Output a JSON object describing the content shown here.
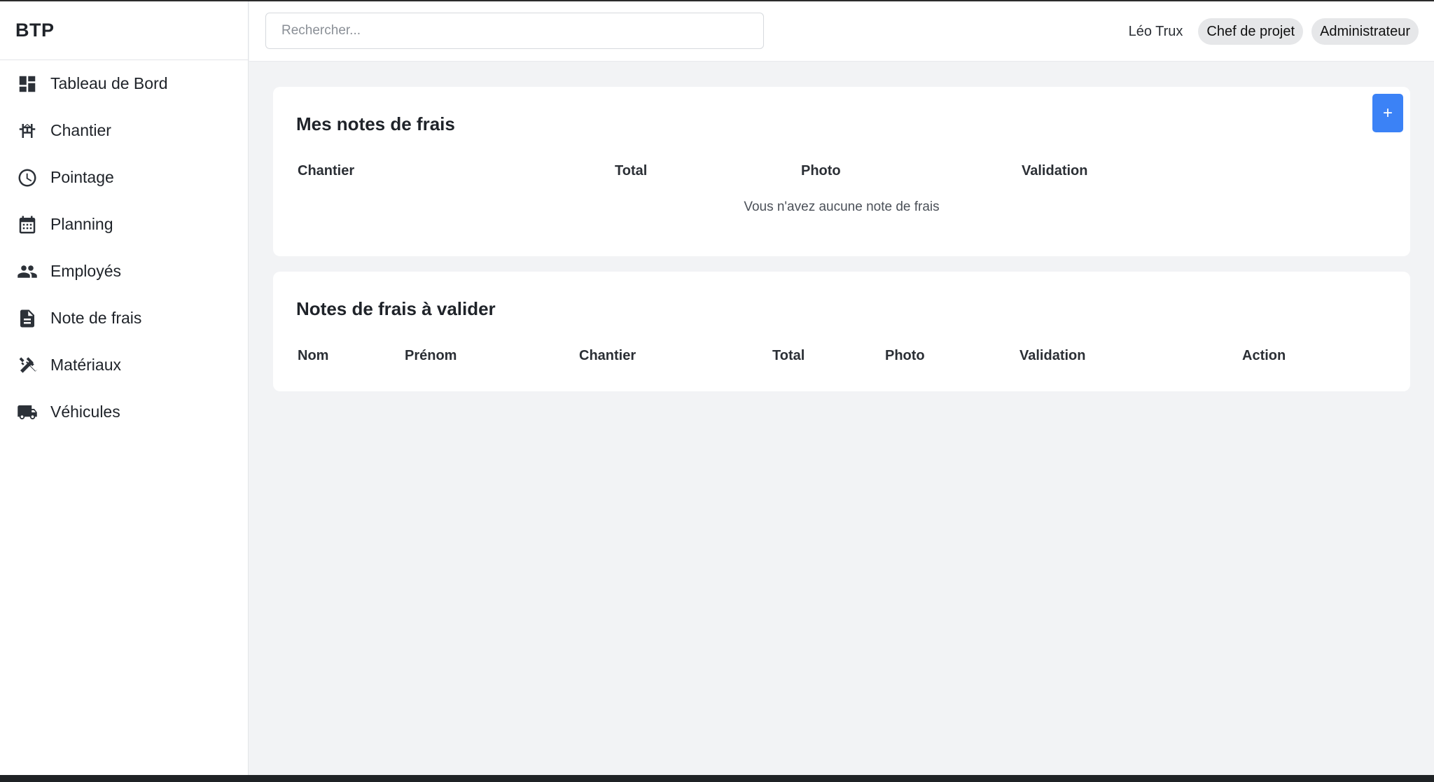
{
  "brand": "BTP",
  "sidebar": {
    "items": [
      {
        "label": "Tableau de Bord",
        "icon": "dashboard-icon"
      },
      {
        "label": "Chantier",
        "icon": "construction-site-icon"
      },
      {
        "label": "Pointage",
        "icon": "clock-icon"
      },
      {
        "label": "Planning",
        "icon": "calendar-icon"
      },
      {
        "label": "Employés",
        "icon": "people-icon"
      },
      {
        "label": "Note de frais",
        "icon": "document-icon"
      },
      {
        "label": "Matériaux",
        "icon": "tools-icon"
      },
      {
        "label": "Véhicules",
        "icon": "truck-icon"
      }
    ]
  },
  "header": {
    "search_placeholder": "Rechercher...",
    "user_name": "Léo Trux",
    "roles": [
      "Chef de projet",
      "Administrateur"
    ]
  },
  "my_expenses": {
    "title": "Mes notes de frais",
    "add_label": "+",
    "columns": [
      "Chantier",
      "Total",
      "Photo",
      "Validation"
    ],
    "empty_message": "Vous n'avez aucune note de frais"
  },
  "to_validate": {
    "title": "Notes de frais à valider",
    "columns": [
      "Nom",
      "Prénom",
      "Chantier",
      "Total",
      "Photo",
      "Validation",
      "Action"
    ]
  },
  "colors": {
    "accent": "#3b82f6",
    "background": "#f2f3f5",
    "pill": "#e6e7e9"
  }
}
